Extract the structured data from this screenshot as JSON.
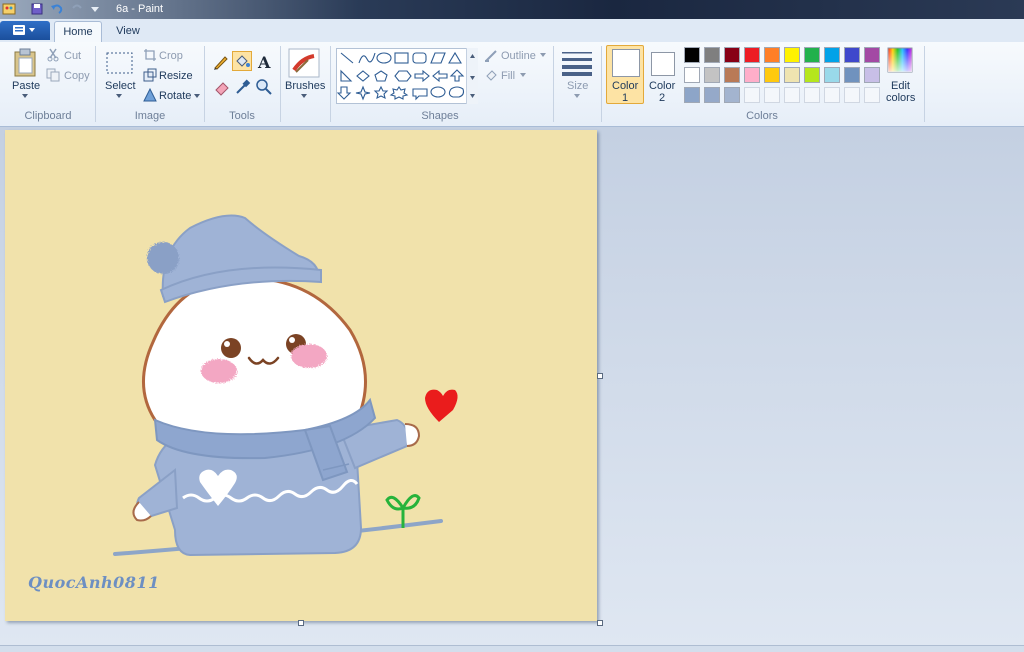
{
  "window": {
    "title": "6a - Paint"
  },
  "tabs": [
    {
      "label": "Home",
      "active": true
    },
    {
      "label": "View",
      "active": false
    }
  ],
  "clipboard": {
    "paste": "Paste",
    "cut": "Cut",
    "copy": "Copy",
    "group": "Clipboard"
  },
  "image": {
    "select": "Select",
    "crop": "Crop",
    "resize": "Resize",
    "rotate": "Rotate",
    "group": "Image"
  },
  "tools": {
    "group": "Tools"
  },
  "brushes": {
    "label": "Brushes"
  },
  "shapes": {
    "outline": "Outline",
    "fill": "Fill",
    "group": "Shapes"
  },
  "size": {
    "label": "Size"
  },
  "colors": {
    "color1_label": "Color",
    "color1_num": "1",
    "color2_label": "Color",
    "color2_num": "2",
    "edit_label": "Edit",
    "edit_label2": "colors",
    "group": "Colors",
    "palette_row1": [
      "#000000",
      "#7f7f7f",
      "#880015",
      "#ed1c24",
      "#ff7f27",
      "#fff200",
      "#22b14c",
      "#00a2e8",
      "#3f48cc",
      "#a349a4"
    ],
    "palette_row2": [
      "#ffffff",
      "#c3c3c3",
      "#b97a57",
      "#ffaec9",
      "#ffc90e",
      "#efe4b0",
      "#b5e61d",
      "#99d9ea",
      "#7092be",
      "#c8bfe7"
    ],
    "palette_row3": [
      "#8da5c8",
      "#95a9c9",
      "#a3b4cf"
    ]
  },
  "canvas": {
    "signature": "QuocAnh0811",
    "background": "#f1e2ab"
  }
}
